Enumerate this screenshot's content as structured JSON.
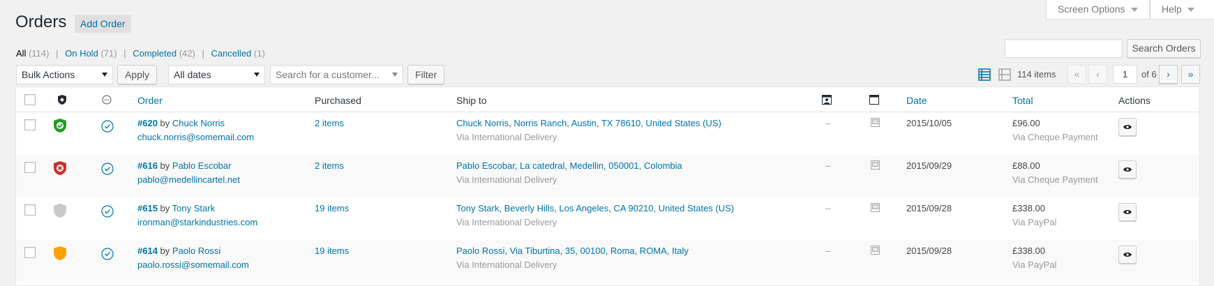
{
  "header": {
    "title": "Orders",
    "add_order": "Add Order",
    "screen_options": "Screen Options",
    "help": "Help"
  },
  "views": {
    "all": {
      "label": "All",
      "count": "(114)"
    },
    "on_hold": {
      "label": "On Hold",
      "count": "(71)"
    },
    "completed": {
      "label": "Completed",
      "count": "(42)"
    },
    "cancelled": {
      "label": "Cancelled",
      "count": "(1)"
    },
    "separator": "|"
  },
  "search": {
    "value": "",
    "button": "Search Orders"
  },
  "tablenav": {
    "bulk_actions": "Bulk Actions",
    "apply": "Apply",
    "date_filter": "All dates",
    "customer_placeholder": "Search for a customer...",
    "filter": "Filter",
    "items": "114 items",
    "first": "«",
    "prev": "‹",
    "current_page": "1",
    "of_pages": "of 6",
    "next": "›",
    "last": "»"
  },
  "columns": {
    "order": "Order",
    "purchased": "Purchased",
    "ship_to": "Ship to",
    "date": "Date",
    "total": "Total",
    "actions": "Actions"
  },
  "icons": {
    "status_col": "shield-icon",
    "notes_col": "circle-icon",
    "customer_msg_col": "profile-card-icon",
    "order_notes_col": "window-icon",
    "view_action": "eye-icon"
  },
  "orders": [
    {
      "number": "#620",
      "by": "by",
      "customer": "Chuck Norris",
      "email": "chuck.norris@somemail.com",
      "purchased": "2 items",
      "ship_to": "Chuck Norris, Norris Ranch, Austin, TX 78610, United States (US)",
      "ship_via": "Via International Delivery",
      "msg": "–",
      "date": "2015/10/05",
      "total": "£96.00",
      "pay_via": "Via Cheque Payment",
      "status_color": "#1e9f1e",
      "status": "check"
    },
    {
      "number": "#616",
      "by": "by",
      "customer": "Pablo Escobar",
      "email": "pablo@medellincartel.net",
      "purchased": "2 items",
      "ship_to": "Pablo Escobar, La catedral, Medellin, 050001, Colombia",
      "ship_via": "Via International Delivery",
      "msg": "–",
      "date": "2015/09/29",
      "total": "£88.00",
      "pay_via": "Via Cheque Payment",
      "status_color": "#c9302c",
      "status": "x"
    },
    {
      "number": "#615",
      "by": "by",
      "customer": "Tony Stark",
      "email": "ironman@starkindustries.com",
      "purchased": "19 items",
      "ship_to": "Tony Stark, Beverly Hills, Los Angeles, CA 90210, United States (US)",
      "ship_via": "Via International Delivery",
      "msg": "–",
      "date": "2015/09/28",
      "total": "£338.00",
      "pay_via": "Via PayPal",
      "status_color": "#c8c8c8",
      "status": "none"
    },
    {
      "number": "#614",
      "by": "by",
      "customer": "Paolo Rossi",
      "email": "paolo.rossi@somemail.com",
      "purchased": "19 items",
      "ship_to": "Paolo Rossi, Via Tiburtina, 35, 00100, Roma, ROMA, Italy",
      "ship_via": "Via International Delivery",
      "msg": "–",
      "date": "2015/09/28",
      "total": "£338.00",
      "pay_via": "Via PayPal",
      "status_color": "#ffa200",
      "status": "none"
    }
  ],
  "colors": {
    "link": "#0073aa",
    "accent_blue": "#0073aa"
  }
}
